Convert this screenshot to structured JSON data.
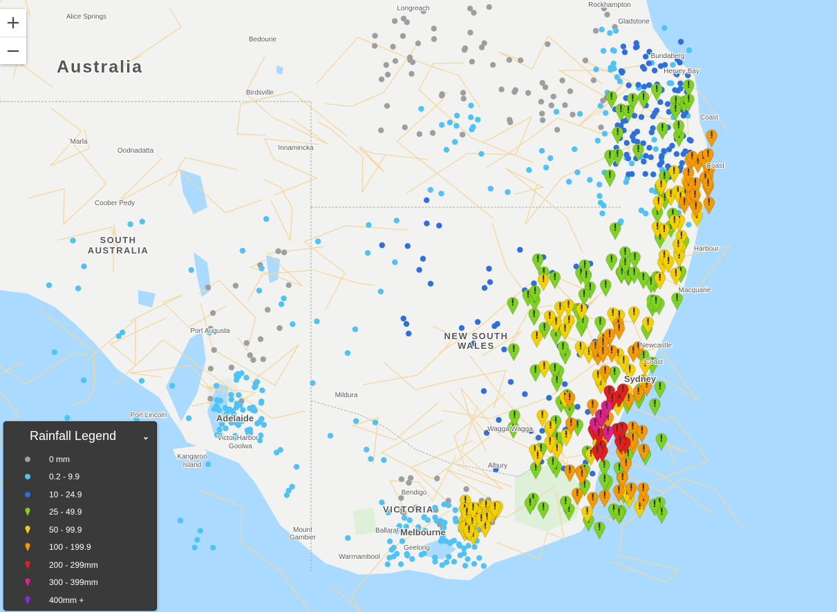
{
  "map_controls": {
    "zoom_in": "+",
    "zoom_out": "−"
  },
  "map_labels": {
    "country": "Australia",
    "states": [
      "SOUTH",
      "AUSTRALIA",
      "NEW SOUTH",
      "WALES",
      "VICTORIA"
    ],
    "places": [
      "Alice Springs",
      "Longreach",
      "Rockhampton",
      "Gladstone",
      "Bundaberg",
      "Hervey Bay",
      "Bedourie",
      "Birdsville",
      "Marla",
      "Oodnadatta",
      "Innamincka",
      "Coober Pedy",
      "Port Augusta",
      "Port Lincoln",
      "Adelaide",
      "Victor Harbor",
      "Goolwa",
      "Kangaroo",
      "Island",
      "Mildura",
      "Wagga Wagga",
      "Albury",
      "Bendigo",
      "Ballarat",
      "Melbourne",
      "Geelong",
      "Mount",
      "Gambier",
      "Warrnambool",
      "Coast",
      "Coast",
      "Harbour",
      "Macquarie",
      "Newcastle",
      "Coast",
      "Sydney"
    ]
  },
  "legend": {
    "title": "Rainfall Legend",
    "toggle_icon": "chevron-down-icon",
    "items": [
      {
        "label": "0 mm",
        "symbol": "dot",
        "color": "#9e9e9e"
      },
      {
        "label": "0.2 - 9.9",
        "symbol": "dot",
        "color": "#4fc3f7"
      },
      {
        "label": "10 - 24.9",
        "symbol": "dot",
        "color": "#2e6fe0"
      },
      {
        "label": "25 - 49.9",
        "symbol": "pin",
        "color": "#7ed321"
      },
      {
        "label": "50 - 99.9",
        "symbol": "pin",
        "color": "#f5d000"
      },
      {
        "label": "100 - 199.9",
        "symbol": "pin",
        "color": "#f59a00"
      },
      {
        "label": "200 - 299mm",
        "symbol": "pin",
        "color": "#e02020"
      },
      {
        "label": "300 - 399mm",
        "symbol": "pin",
        "color": "#e0208a"
      },
      {
        "label": "400mm +",
        "symbol": "pin",
        "color": "#8a2be2"
      }
    ]
  },
  "colors": {
    "sea": "#aadaff",
    "land": "#f2f2f0",
    "water": "#aadaff",
    "park": "#dff0d8",
    "road": "#f7d58c",
    "border": "#a0a0a0"
  }
}
